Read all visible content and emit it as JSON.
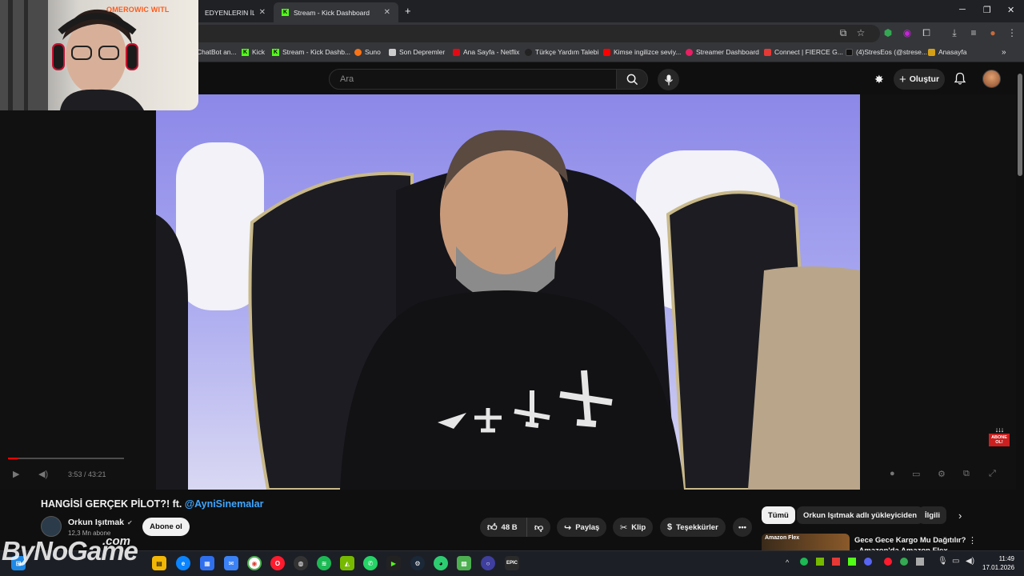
{
  "browser": {
    "tabs": [
      {
        "label": "EDYENLERIN İLK Vİ:",
        "active": false
      },
      {
        "label": "Stream - Kick Dashboard",
        "active": true
      }
    ],
    "new_tab": "+",
    "bookmarks": [
      {
        "label": "ChatBot an...",
        "color": "#888888"
      },
      {
        "label": "Kick",
        "color": "#53fc18"
      },
      {
        "label": "Stream - Kick Dashb...",
        "color": "#53fc18"
      },
      {
        "label": "Suno",
        "color": "#f97316"
      },
      {
        "label": "Son Depremler",
        "color": "#cccccc"
      },
      {
        "label": "Ana Sayfa - Netflix",
        "color": "#e50914"
      },
      {
        "label": "Türkçe Yardım Talebi",
        "color": "#222222"
      },
      {
        "label": "Kimse ingilizce seviy...",
        "color": "#ff0000"
      },
      {
        "label": "Streamer Dashboard",
        "color": "#e91e63"
      },
      {
        "label": "Connect | FIERCE G...",
        "color": "#e53935"
      },
      {
        "label": "(4)StresEos (@strese...",
        "color": "#111111"
      },
      {
        "label": "Anasayfa",
        "color": "#d4a017"
      }
    ]
  },
  "webcam": {
    "name": "OMEROWIC WITL"
  },
  "youtube": {
    "search_placeholder": "Ara",
    "create_label": "Oluştur",
    "player": {
      "timecode": "3:53 / 43:21",
      "progress": 0.09
    },
    "video": {
      "title": "HANGİSİ GERÇEK PİLOT?! ft.",
      "title_mention": "@AyniSinemalar",
      "channel": "Orkun Işıtmak",
      "subscribers": "12,3 Mn abone",
      "subscribe_label": "Abone ol",
      "likes": "48 B",
      "share_label": "Paylaş",
      "clip_label": "Klip",
      "thanks_label": "Teşekkürler"
    },
    "chips": [
      "Tümü",
      "Orkun Işıtmak adlı yükleyiciden",
      "İlgili"
    ],
    "recommended": {
      "thumb_text": "Amazon Flex",
      "title": "Gece Gece Kargo Mu Dağıtılır? - Amazon'da Amazon Flex"
    },
    "abone_badge": "ABONE OL!"
  },
  "taskbar": {
    "time": "11:49",
    "date": "17.01.2026"
  },
  "watermark": {
    "text": "ByNoGame",
    "suffix": ".com"
  }
}
